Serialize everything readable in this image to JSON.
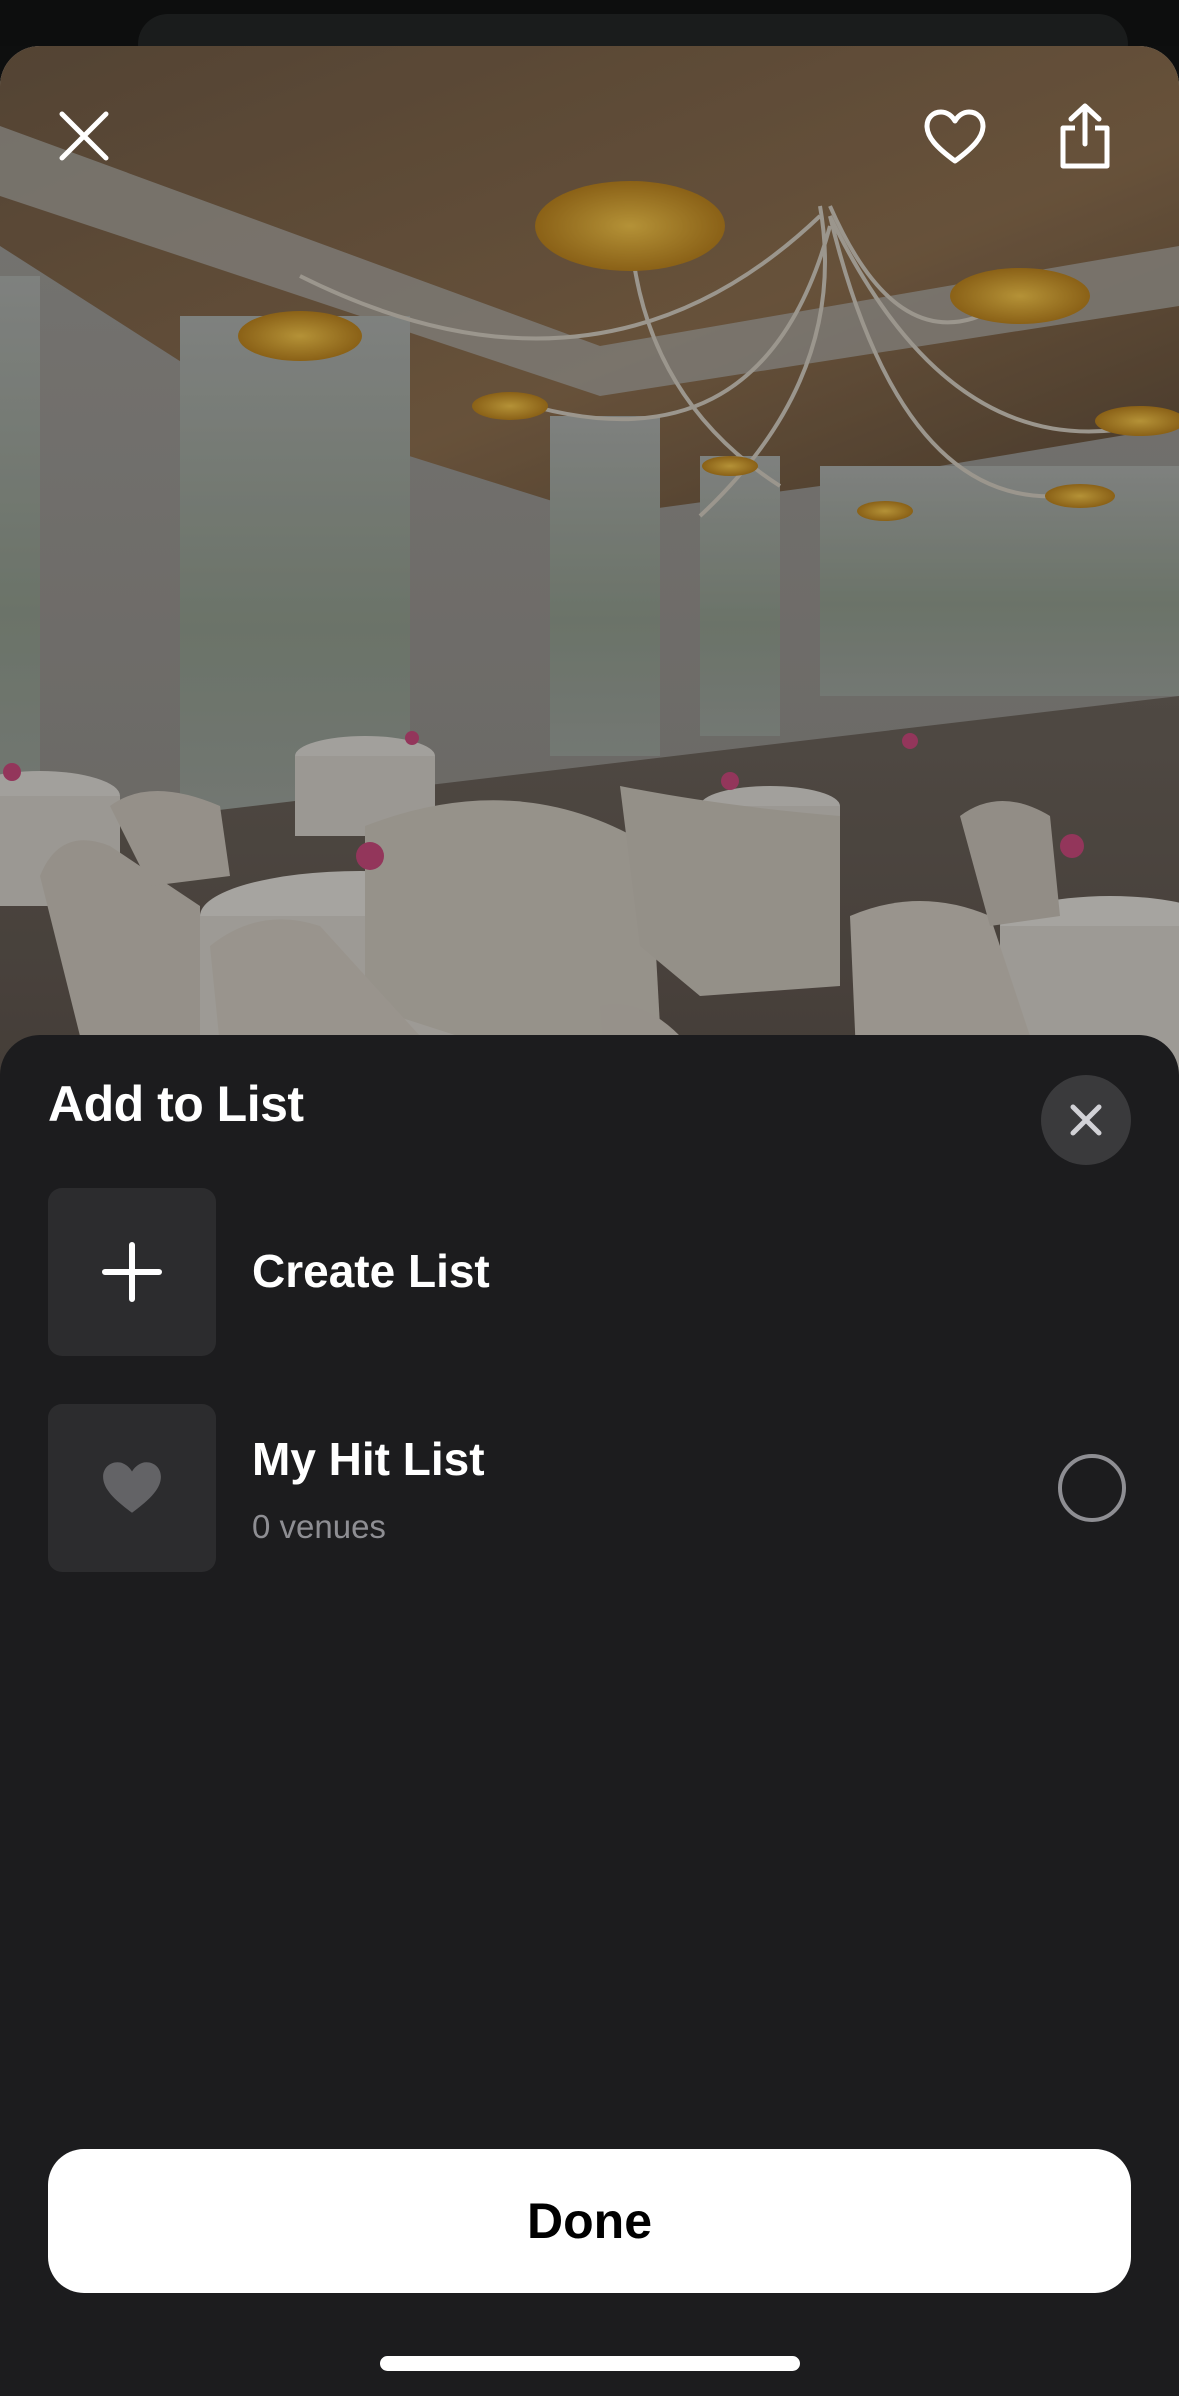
{
  "sheet": {
    "title": "Add to List",
    "items": [
      {
        "label": "Create List",
        "icon": "plus-icon"
      },
      {
        "label": "My Hit List",
        "sublabel": "0 venues",
        "icon": "heart-icon",
        "selected": false
      }
    ],
    "done_label": "Done"
  },
  "photo": {
    "subject": "restaurant-dining-room",
    "actions": [
      "close-icon",
      "heart-outline-icon",
      "share-icon"
    ]
  },
  "colors": {
    "sheet_background": "#1c1c1e",
    "tile_background": "#2c2c2e",
    "secondary_text": "#8e8e93",
    "primary_button": "#ffffff"
  }
}
